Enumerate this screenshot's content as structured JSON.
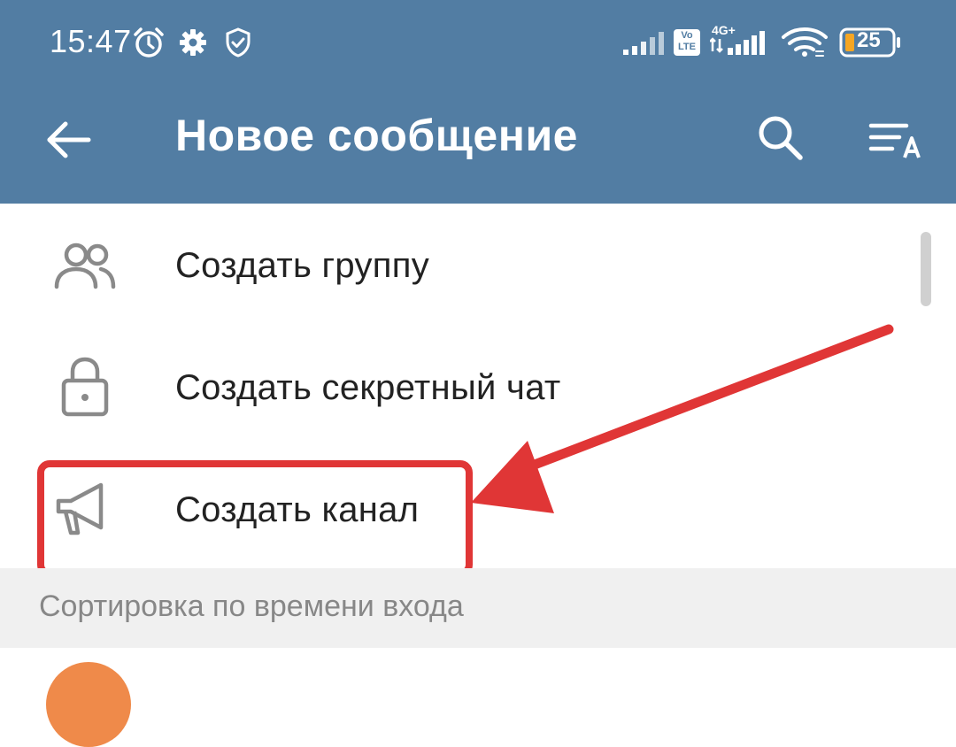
{
  "status_bar": {
    "time": "15:47",
    "battery_level": "25",
    "volte_label": "Vo LTE",
    "network_type": "4G+",
    "icons": [
      "alarm-icon",
      "gear-icon",
      "shield-check-icon",
      "signal-icon",
      "volte-icon",
      "signal-4g-icon",
      "wifi-icon",
      "battery-icon"
    ]
  },
  "toolbar": {
    "title": "Новое сообщение",
    "icons": [
      "back-arrow-icon",
      "search-icon",
      "sort-alpha-icon"
    ]
  },
  "menu": {
    "items": [
      {
        "label": "Создать группу",
        "icon": "group-icon"
      },
      {
        "label": "Создать секретный чат",
        "icon": "lock-icon"
      },
      {
        "label": "Создать канал",
        "icon": "megaphone-icon"
      }
    ]
  },
  "section": {
    "label": "Сортировка по времени входа"
  },
  "colors": {
    "header": "#527da3",
    "annotation": "#e03636",
    "section_bg": "#f0f0f0",
    "avatar": "#ef8a4a"
  }
}
